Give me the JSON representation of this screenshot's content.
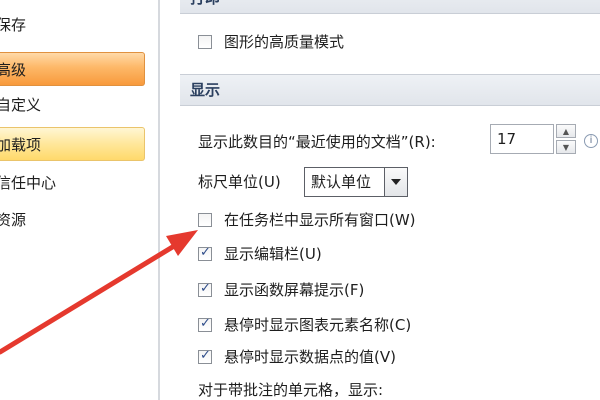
{
  "sidebar": {
    "items": [
      {
        "label": "保存",
        "state": "normal"
      },
      {
        "label": "高级",
        "state": "active"
      },
      {
        "label": "自定义",
        "state": "normal"
      },
      {
        "label": "加载项",
        "state": "hover"
      },
      {
        "label": "信任中心",
        "state": "normal"
      },
      {
        "label": "资源",
        "state": "normal"
      }
    ]
  },
  "main": {
    "top_header": "打印",
    "hq_graphics_label": "图形的高质量模式",
    "display_header": "显示",
    "recent_docs_label": "显示此数目的“最近使用的文档”(R):",
    "recent_docs_value": "17",
    "ruler_label": "标尺单位(U)",
    "ruler_value": "默认单位",
    "info_icon": "i",
    "options": [
      {
        "label": "在任务栏中显示所有窗口(W)",
        "checked": false
      },
      {
        "label": "显示编辑栏(U)",
        "checked": true
      },
      {
        "label": "显示函数屏幕提示(F)",
        "checked": true
      },
      {
        "label": "悬停时显示图表元素名称(C)",
        "checked": true
      },
      {
        "label": "悬停时显示数据点的值(V)",
        "checked": true
      }
    ],
    "comments_label": "对于带批注的单元格，显示:"
  },
  "colors": {
    "active_item": "#f89a3c",
    "hover_item": "#ffe79a",
    "annotation_arrow": "#e5392e",
    "section_header_text": "#2a3f5f"
  }
}
